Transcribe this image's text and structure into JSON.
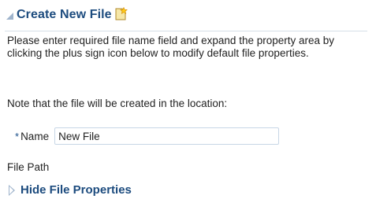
{
  "header": {
    "title": "Create New File",
    "icon": "new-file-icon",
    "collapse_icon": "collapse-triangle-icon"
  },
  "body": {
    "instructions": "Please enter required file name field and expand the property area by clicking the plus sign icon below to modify default file properties.",
    "location_note": "Note that the file will be created in the location:"
  },
  "form": {
    "required_marker": "*",
    "name_label": "Name",
    "name_value": "New File",
    "file_path_label": "File Path"
  },
  "properties": {
    "toggle_label": "Hide File Properties",
    "toggle_icon": "disclosure-triangle-icon"
  },
  "colors": {
    "title": "#1c4b7e",
    "accent_triangle": "#9fb4cc",
    "input_border": "#c7d6e6"
  }
}
